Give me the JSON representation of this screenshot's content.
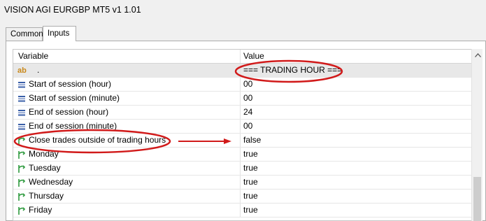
{
  "window": {
    "title": "VISION AGI EURGBP MT5 v1 1.01"
  },
  "tabs": [
    {
      "label": "Common",
      "active": false
    },
    {
      "label": "Inputs",
      "active": true
    }
  ],
  "table": {
    "columns": {
      "variable": "Variable",
      "value": "Value"
    },
    "rows": [
      {
        "type": "string",
        "icon": "ab-icon",
        "variable": ".",
        "value": "=== TRADING HOUR ==="
      },
      {
        "type": "number",
        "icon": "number-icon",
        "variable": "Start of session (hour)",
        "value": "00"
      },
      {
        "type": "number",
        "icon": "number-icon",
        "variable": "Start of session (minute)",
        "value": "00"
      },
      {
        "type": "number",
        "icon": "number-icon",
        "variable": "End of session (hour)",
        "value": "24"
      },
      {
        "type": "number",
        "icon": "number-icon",
        "variable": "End of session (minute)",
        "value": "00"
      },
      {
        "type": "bool",
        "icon": "bool-icon",
        "variable": "Close trades outside of trading hours",
        "value": "false"
      },
      {
        "type": "bool",
        "icon": "bool-icon",
        "variable": "Monday",
        "value": "true"
      },
      {
        "type": "bool",
        "icon": "bool-icon",
        "variable": "Tuesday",
        "value": "true"
      },
      {
        "type": "bool",
        "icon": "bool-icon",
        "variable": "Wednesday",
        "value": "true"
      },
      {
        "type": "bool",
        "icon": "bool-icon",
        "variable": "Thursday",
        "value": "true"
      },
      {
        "type": "bool",
        "icon": "bool-icon",
        "variable": "Friday",
        "value": "true"
      }
    ]
  },
  "colors": {
    "annotation": "#d11a1a",
    "group_row": "#e8e8e8",
    "number_icon": "#3a5fa8",
    "bool_icon": "#2e9a3e",
    "ab_icon": "#c9881a"
  }
}
